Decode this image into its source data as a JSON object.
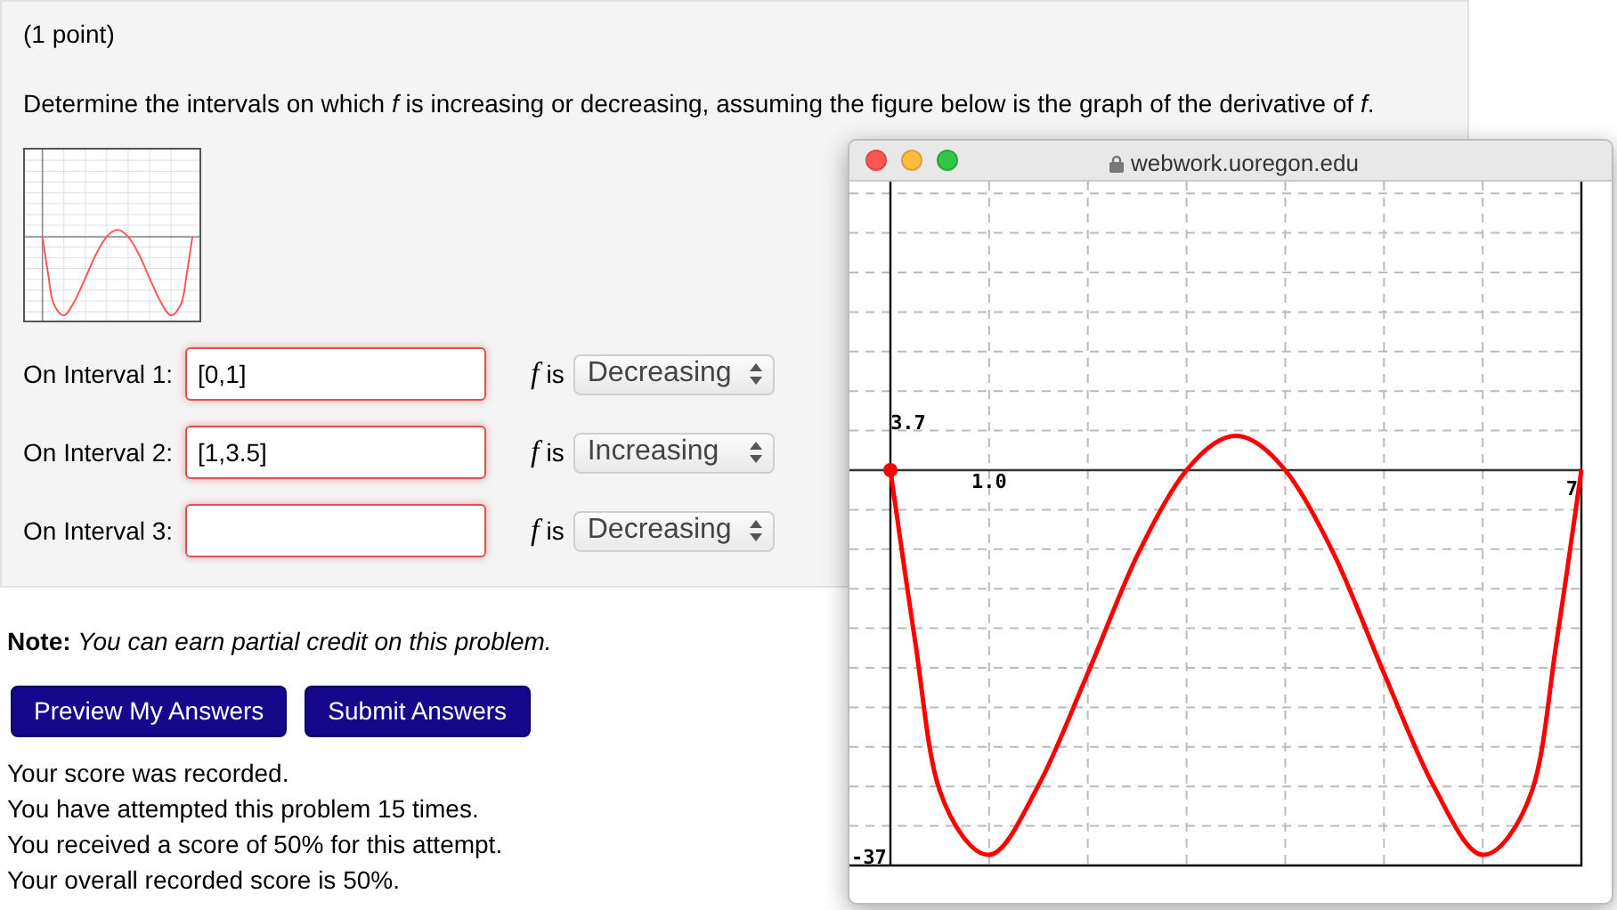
{
  "problem": {
    "points": "(1 point)",
    "question": "Determine the intervals on which *f* is increasing or decreasing, assuming the figure below is the graph of the derivative of *f*.",
    "intervals": [
      {
        "label": "On Interval 1:",
        "value": "[0,1]",
        "f": "f",
        "is": "is",
        "choice": "Decreasing"
      },
      {
        "label": "On Interval 2:",
        "value": "[1,3.5]",
        "f": "f",
        "is": "is",
        "choice": "Increasing"
      },
      {
        "label": "On Interval 3:",
        "f": "f",
        "is": "is",
        "choice": "Decreasing"
      }
    ]
  },
  "note": {
    "label": "Note:",
    "text": "You can earn partial credit on this problem."
  },
  "buttons": [
    "Preview My Answers",
    "Submit Answers"
  ],
  "messages": [
    "Your score was recorded.",
    "You have attempted this problem 15 times.",
    "You received a score of 50% for this attempt.",
    "Your overall recorded score is 50%."
  ],
  "popup": {
    "url": "webwork.uoregon.edu",
    "graph_labels": [
      "3.7",
      "1.0",
      "7",
      "-37"
    ]
  }
}
